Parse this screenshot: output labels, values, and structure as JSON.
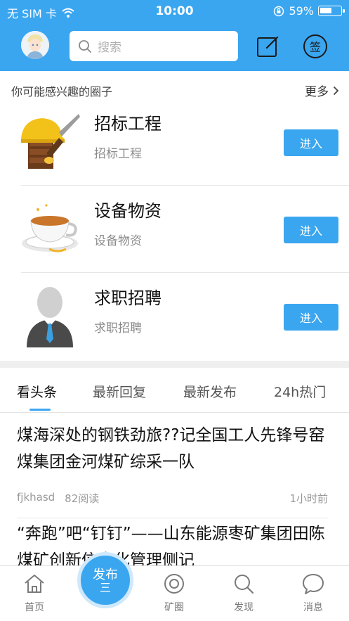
{
  "status_bar": {
    "carrier": "无 SIM 卡",
    "time": "10:00",
    "battery": "59%",
    "battery_level": 0.59
  },
  "header": {
    "search_placeholder": "搜索"
  },
  "circles": {
    "title": "你可能感兴趣的圈子",
    "more_label": "更多",
    "items": [
      {
        "name": "招标工程",
        "subtitle": "招标工程",
        "enter_label": "进入",
        "icon": "hard-hat-trowel-icon"
      },
      {
        "name": "设备物资",
        "subtitle": "设备物资",
        "enter_label": "进入",
        "icon": "teacup-icon"
      },
      {
        "name": "求职招聘",
        "subtitle": "求职招聘",
        "enter_label": "进入",
        "icon": "person-silhouette-icon"
      }
    ]
  },
  "tabs": [
    "看头条",
    "最新回复",
    "最新发布",
    "24h热门"
  ],
  "articles": [
    {
      "title": "煤海深处的钢铁劲旅??记全国工人先锋号窑煤集团金河煤矿综采一队",
      "author": "fjkhasd",
      "reads": "82阅读",
      "time": "1小时前"
    },
    {
      "title": "“奔跑”吧“钉钉”——山东能源枣矿集团田陈煤矿创新信息化管理侧记"
    }
  ],
  "bottom_nav": {
    "home": "首页",
    "publish": "发布",
    "publish_symbol": "三",
    "circle": "矿圈",
    "discover": "发现",
    "messages": "消息"
  },
  "colors": {
    "accent": "#3aa6f0",
    "divider": "#e6e6e6",
    "muted_text": "#8a8a8a"
  }
}
